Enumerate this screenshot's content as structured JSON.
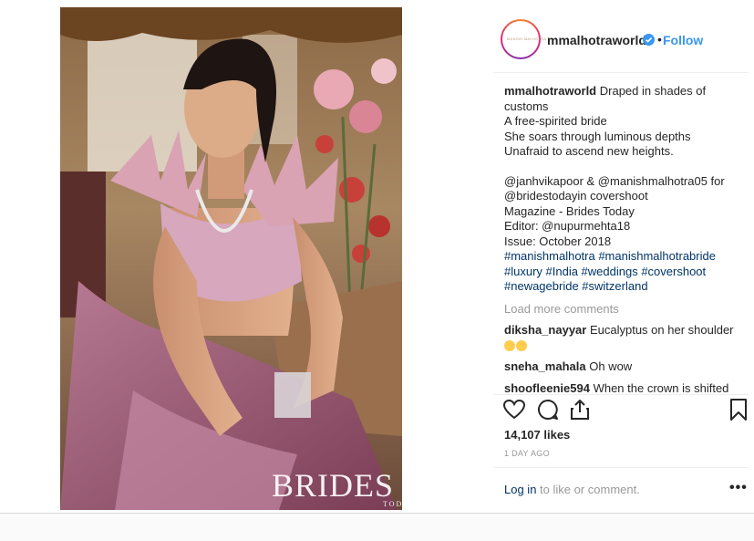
{
  "post": {
    "photo": {
      "overlay_logo": "BRIDES",
      "overlay_sub": "TODAY"
    },
    "header": {
      "avatar_text": "MANISH MALHOTRA",
      "username": "mmalhotraworld",
      "separator": "•",
      "follow_label": "Follow",
      "verified_icon": "verified-badge-icon"
    },
    "caption": {
      "user": "mmalhotraworld",
      "lines": [
        "Draped in shades of",
        "customs",
        "A free-spirited bride",
        "She soars through luminous depths",
        "Unafraid to ascend new heights."
      ],
      "credits": [
        "@janhvikapoor & @manishmalhotra05 for",
        "@bridestodayin covershoot",
        "Magazine - Brides Today",
        "Editor: @nupurmehta18",
        "Issue: October 2018",
        "#manishmalhotra #manishmalhotrabride",
        "#luxury #India #weddings #covershoot",
        "#newagebride #switzerland"
      ]
    },
    "load_more": "Load more comments",
    "comments": [
      {
        "user": "diksha_nayyar",
        "text": "Eucalyptus on her shoulder"
      },
      {
        "user": "sneha_mahala",
        "text": "Oh wow"
      },
      {
        "user": "shoofleenie594",
        "text": "When the crown is shifted"
      }
    ],
    "likes": "14,107 likes",
    "time": "1 DAY AGO",
    "login_link": "Log in",
    "login_rest": " to like or comment.",
    "more_label": "•••",
    "colors": {
      "link": "#003569",
      "follow": "#3897f0",
      "muted": "#999999",
      "text": "#262626"
    }
  }
}
